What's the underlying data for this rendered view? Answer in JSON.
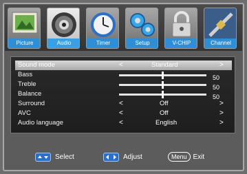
{
  "tabs": [
    {
      "label": "Picture",
      "icon": "picture-icon"
    },
    {
      "label": "Audio",
      "icon": "speaker-icon",
      "active": true
    },
    {
      "label": "Timer",
      "icon": "clock-icon"
    },
    {
      "label": "Setup",
      "icon": "gears-icon"
    },
    {
      "label": "V-CHIP",
      "icon": "lock-icon"
    },
    {
      "label": "Channel",
      "icon": "satellite-icon"
    }
  ],
  "audio_menu": {
    "sound_mode": {
      "label": "Sound  mode",
      "value": "Standard"
    },
    "bass": {
      "label": "Bass",
      "value": "50",
      "level": 0.5
    },
    "treble": {
      "label": "Treble",
      "value": "50",
      "level": 0.5
    },
    "balance": {
      "label": "Balance",
      "value": "50",
      "level": 0.5
    },
    "surround": {
      "label": "Surround",
      "value": "Off"
    },
    "avc": {
      "label": "AVC",
      "value": "Off"
    },
    "audio_language": {
      "label": "Audio language",
      "value": "English"
    },
    "left_arrow": "<",
    "right_arrow": ">"
  },
  "footer": {
    "select_label": "Select",
    "adjust_label": "Adjust",
    "menu_key": "Menu",
    "exit_label": "Exit"
  },
  "colors": {
    "accent": "#2f8fd6",
    "panel": "#222222",
    "selection": "#c8c8c8"
  }
}
